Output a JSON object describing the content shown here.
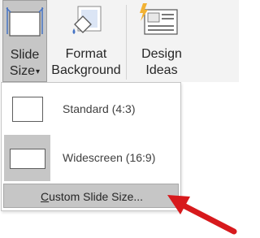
{
  "ribbon": {
    "slide_size": {
      "line1": "Slide",
      "line2": "Size",
      "caret": "▾"
    },
    "format_background": {
      "line1": "Format",
      "line2": "Background"
    },
    "design_ideas": {
      "line1": "Design",
      "line2": "Ideas"
    }
  },
  "menu": {
    "items": [
      {
        "label": "Standard (4:3)"
      },
      {
        "label": "Widescreen (16:9)"
      }
    ],
    "custom": {
      "accel": "C",
      "rest": "ustom Slide Size..."
    }
  },
  "colors": {
    "arrow": "#d7191c",
    "hover": "#c6c6c6",
    "brand": "#4472c4"
  },
  "icons": [
    "slide-size-icon",
    "format-background-icon",
    "design-ideas-icon",
    "red-arrow-icon"
  ]
}
